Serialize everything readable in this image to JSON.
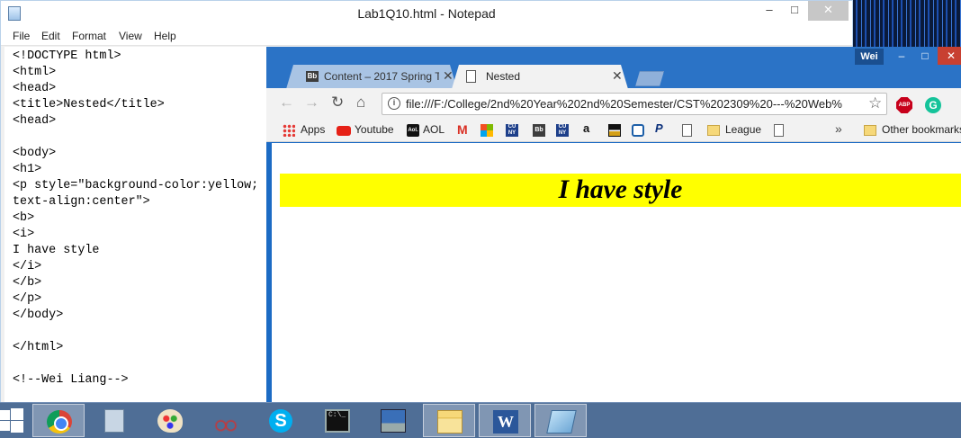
{
  "notepad": {
    "title": "Lab1Q10.html - Notepad",
    "window_controls": {
      "minimize": "–",
      "maximize": "□",
      "close": "✕"
    },
    "menu": [
      "File",
      "Edit",
      "Format",
      "View",
      "Help"
    ],
    "content": "<!DOCTYPE html>\n<html>\n<head>\n<title>Nested</title>\n<head>\n\n<body>\n<h1>\n<p style=\"background-color:yellow;\ntext-align:center\">\n<b>\n<i>\nI have style\n</i>\n</b>\n</p>\n</body>\n\n</html>\n\n<!--Wei Liang-->"
  },
  "chrome": {
    "profile_name": "Wei",
    "window_controls": {
      "minimize": "–",
      "maximize": "□",
      "close": "✕"
    },
    "tabs": [
      {
        "favicon": "Bb",
        "label": "Content – 2017 Spring Te",
        "close": "✕",
        "active": false
      },
      {
        "favicon": "document-icon",
        "label": "Nested",
        "close": "✕",
        "active": true
      }
    ],
    "nav": {
      "back": "←",
      "forward": "→",
      "reload": "↻",
      "home": "⌂"
    },
    "address_bar": {
      "url": "file:///F:/College/2nd%20Year%202nd%20Semester/CST%202309%20---%20Web%",
      "star": "☆"
    },
    "extensions": {
      "abp": "ABP",
      "grammarly": "G"
    },
    "bookmarks": {
      "apps": "Apps",
      "youtube": "Youtube",
      "aol_icon": "Aol.",
      "aol": "AOL",
      "gmail_icon": "M",
      "cuny_icon": "CU NY",
      "blackboard_icon": "Bb",
      "amazon_icon": "a",
      "paypal_icon": "P",
      "league": "League",
      "more": "»",
      "other": "Other bookmarks"
    },
    "page": {
      "text": "I have style",
      "background": "#ffff00"
    }
  },
  "taskbar": {
    "items": [
      "chrome",
      "calculator",
      "paint",
      "snipping-tool",
      "skype",
      "command-prompt",
      "remote-desktop",
      "file-explorer",
      "word",
      "notepad"
    ],
    "skype_glyph": "S",
    "cmd_glyph": "C:\\_",
    "word_glyph": "W"
  }
}
